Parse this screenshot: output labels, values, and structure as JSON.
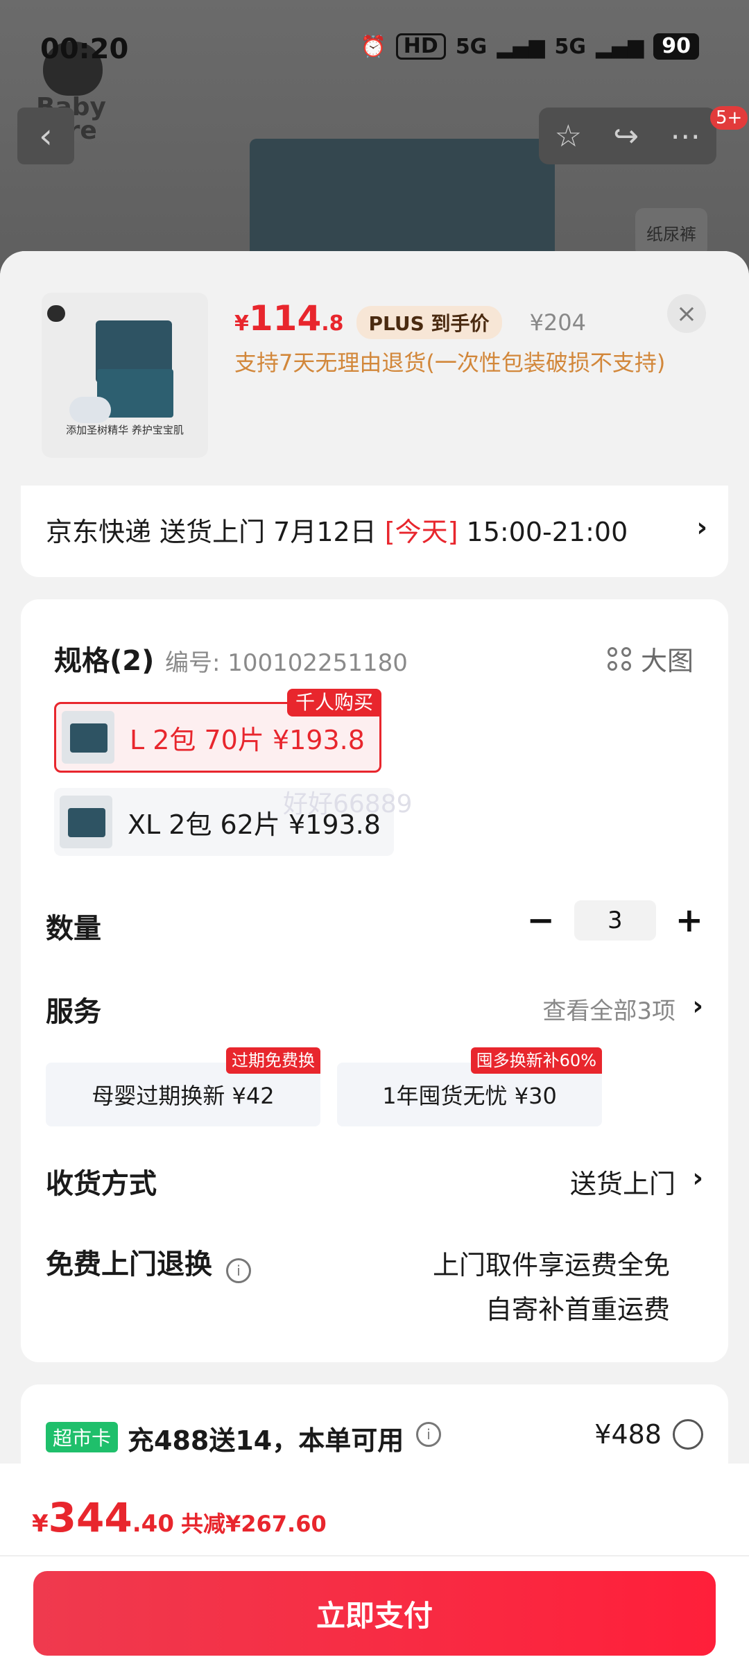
{
  "status": {
    "time": "00:20",
    "hd": "HD",
    "sig5g_a": "5G",
    "sig5g_b": "5G",
    "battery": "90"
  },
  "bg": {
    "logo_line1": "Baby",
    "logo_line2": "care",
    "badge": "5+",
    "tag": "纸尿裤"
  },
  "product": {
    "thumb_caption": "添加圣树精华 养护宝宝肌",
    "price_currency": "¥",
    "price_int": "114",
    "price_dec": ".8",
    "plus_label": "PLUS 到手价",
    "orig_price": "¥204",
    "return_note": "支持7天无理由退货(一次性包装破损不支持)"
  },
  "delivery": {
    "prefix": "京东快递 送货上门 7月12日 ",
    "today": "[今天]",
    "window": " 15:00-21:00"
  },
  "specs": {
    "title": "规格(2)",
    "code": "编号: 100102251180",
    "big_image": "大图",
    "options": [
      {
        "label": "L 2包 70片  ¥193.8",
        "tag": "千人购买",
        "selected": true
      },
      {
        "label": "XL 2包 62片  ¥193.8",
        "selected": false
      }
    ]
  },
  "qty": {
    "label": "数量",
    "minus": "−",
    "value": "3",
    "plus": "+"
  },
  "service": {
    "label": "服务",
    "more": "查看全部3项",
    "items": [
      {
        "text": "母婴过期换新  ¥42",
        "tag": "过期免费换"
      },
      {
        "text": "1年囤货无忧  ¥30",
        "tag": "囤多换新补60%"
      }
    ]
  },
  "receive": {
    "label": "收货方式",
    "value": "送货上门"
  },
  "free_return": {
    "label": "免费上门退换",
    "line1": "上门取件享运费全免",
    "line2": "自寄补首重运费"
  },
  "watermark": "好好66889",
  "market": {
    "tag": "超市卡",
    "text": "充488送14，本单可用",
    "price": "¥488"
  },
  "footer": {
    "currency": "¥",
    "total_int": "344",
    "total_dec": ".40",
    "saving": "共减¥267.60",
    "pay_label": "立即支付"
  },
  "colors": {
    "accent": "#e8262d",
    "pay_start": "#ef3a4e",
    "pay_end": "#ff1f3a",
    "plus_bg": "#f7e6d6",
    "note": "#d2873a",
    "market_tag": "#1fbf6b"
  }
}
